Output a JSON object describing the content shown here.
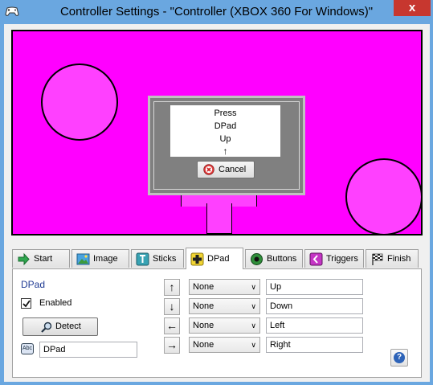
{
  "window": {
    "title": "Controller Settings - \"Controller (XBOX 360 For Windows)\"",
    "close_glyph": "x",
    "icon": "gamepad-icon"
  },
  "preview": {
    "background_color": "#ff00ff",
    "dialog": {
      "line1": "Press",
      "line2": "DPad",
      "line3": "Up",
      "arrow": "↑",
      "cancel_label": "Cancel"
    }
  },
  "tabs": [
    {
      "label": "Start",
      "icon": "green-arrow-icon"
    },
    {
      "label": "Image",
      "icon": "image-icon"
    },
    {
      "label": "Sticks",
      "icon": "stick-icon"
    },
    {
      "label": "DPad",
      "icon": "dpad-icon",
      "active": true
    },
    {
      "label": "Buttons",
      "icon": "button-icon"
    },
    {
      "label": "Triggers",
      "icon": "trigger-icon"
    },
    {
      "label": "Finish",
      "icon": "checkered-flag-icon"
    }
  ],
  "dpad_panel": {
    "title": "DPad",
    "enabled_label": "Enabled",
    "enabled_checked": true,
    "detect_label": "Detect",
    "name_value": "DPad",
    "name_icon_text": "Abc",
    "directions": [
      {
        "arrow": "↑",
        "mapping": "None",
        "name": "Up"
      },
      {
        "arrow": "↓",
        "mapping": "None",
        "name": "Down"
      },
      {
        "arrow": "←",
        "mapping": "None",
        "name": "Left"
      },
      {
        "arrow": "→",
        "mapping": "None",
        "name": "Right"
      }
    ],
    "help_glyph": "?"
  }
}
